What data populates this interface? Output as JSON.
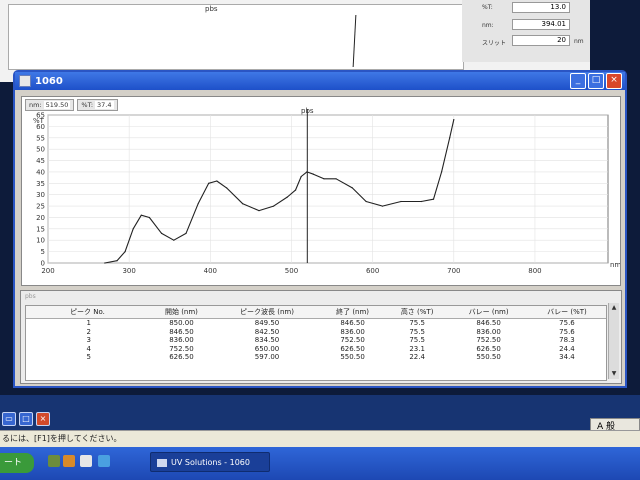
{
  "background_window": {
    "plot_title": "pbs",
    "fields": [
      {
        "label": "%T:",
        "value": "13.0"
      },
      {
        "label": "nm:",
        "value": "394.01"
      },
      {
        "label": "スリット",
        "value": "20",
        "unit": "nm"
      }
    ]
  },
  "window": {
    "title": "1060",
    "controls": {
      "minimize": "_",
      "maximize": "□",
      "close": "×"
    }
  },
  "readout": {
    "nm_label": "nm:",
    "nm_value": "519.50",
    "t_label": "%T:",
    "t_value": "37.4"
  },
  "chart_data": {
    "type": "line",
    "title": "pbs",
    "ylabel": "%T",
    "xlabel": "nm",
    "xlim": [
      200,
      890
    ],
    "ylim": [
      0,
      65
    ],
    "x_ticks": [
      "200",
      "300",
      "400",
      "500",
      "600",
      "700",
      "800"
    ],
    "y_ticks": [
      "0",
      "5",
      "10",
      "15",
      "20",
      "25",
      "30",
      "35",
      "40",
      "45",
      "50",
      "55",
      "60",
      "65"
    ],
    "cursor_x": 519.5,
    "series": [
      {
        "name": "pbs",
        "color": "#222222",
        "points": [
          [
            270,
            0
          ],
          [
            285,
            1
          ],
          [
            295,
            5
          ],
          [
            305,
            15
          ],
          [
            315,
            21
          ],
          [
            325,
            20
          ],
          [
            340,
            13
          ],
          [
            355,
            10
          ],
          [
            370,
            13
          ],
          [
            385,
            26
          ],
          [
            398,
            35
          ],
          [
            408,
            36
          ],
          [
            420,
            33
          ],
          [
            440,
            26
          ],
          [
            460,
            23
          ],
          [
            478,
            25
          ],
          [
            495,
            29
          ],
          [
            505,
            32
          ],
          [
            512,
            38
          ],
          [
            519,
            40
          ],
          [
            527,
            39
          ],
          [
            540,
            37
          ],
          [
            555,
            37
          ],
          [
            575,
            33
          ],
          [
            592,
            27
          ],
          [
            612,
            25
          ],
          [
            635,
            27
          ],
          [
            660,
            27
          ],
          [
            675,
            28
          ],
          [
            685,
            40
          ],
          [
            695,
            55
          ],
          [
            700,
            63
          ]
        ]
      }
    ]
  },
  "peak_table": {
    "caption": "pbs",
    "columns": [
      "ピーク No.",
      "開始 (nm)",
      "ピーク波長 (nm)",
      "終了 (nm)",
      "高さ (%T)",
      "バレー (nm)",
      "バレー (%T)"
    ],
    "rows": [
      [
        "1",
        "850.00",
        "849.50",
        "846.50",
        "75.5",
        "846.50",
        "75.6"
      ],
      [
        "2",
        "846.50",
        "842.50",
        "836.00",
        "75.5",
        "836.00",
        "75.6"
      ],
      [
        "3",
        "836.00",
        "834.50",
        "752.50",
        "75.5",
        "752.50",
        "78.3"
      ],
      [
        "4",
        "752.50",
        "650.00",
        "626.50",
        "23.1",
        "626.50",
        "24.4"
      ],
      [
        "5",
        "626.50",
        "597.00",
        "550.50",
        "22.4",
        "550.50",
        "34.4"
      ]
    ]
  },
  "status_bar": {
    "text": "るには、[F1]を押してください。"
  },
  "ime": {
    "label": "A 般"
  },
  "taskbar": {
    "start_label": "ート",
    "task_button": "UV Solutions - 1060"
  }
}
